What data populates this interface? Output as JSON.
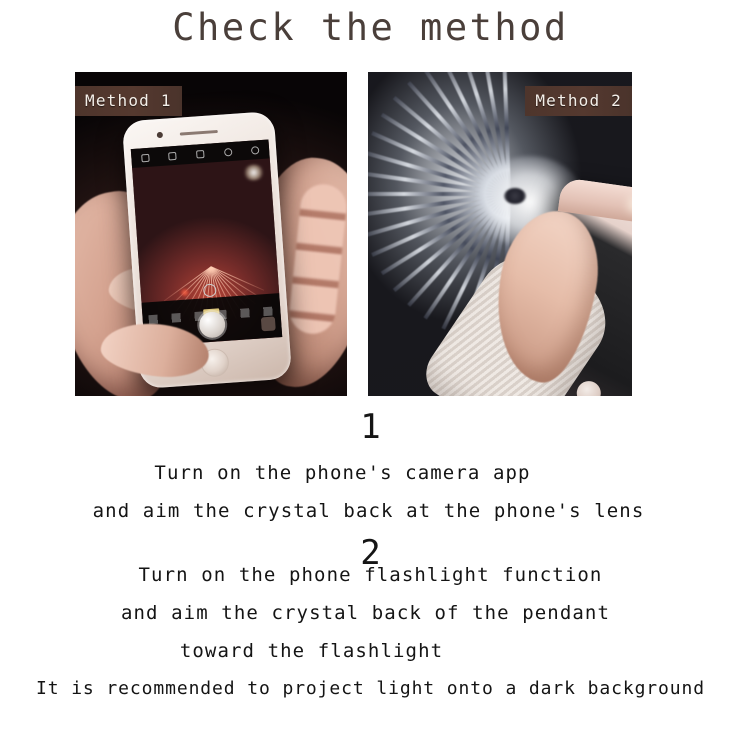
{
  "page": {
    "title": "Check the method",
    "background_color": "#ffffff",
    "title_color": "#4a3f3a",
    "text_color": "#141414"
  },
  "panels": [
    {
      "badge_label": "Method 1",
      "badge_position": "left",
      "badge_bg_color": "#4a332c",
      "badge_text_color": "#f4efe9",
      "scene": "two hands holding a white iPhone in a dark room with the camera app open, showing the crystal's radiating projection on screen"
    },
    {
      "badge_label": "Method 2",
      "badge_position": "right",
      "badge_bg_color": "#4a332c",
      "badge_text_color": "#f4efe9",
      "scene": "a hand holding a rose-gold iPhone with the flashlight on, projecting radial lines of text onto a dark surface"
    }
  ],
  "steps": [
    {
      "number": "1",
      "lines": [
        "Turn on the phone's camera app",
        "and aim the crystal back at the phone's lens"
      ]
    },
    {
      "number": "2",
      "lines": [
        "Turn on the phone flashlight function",
        "and aim the crystal back of the pendant",
        "toward the flashlight"
      ]
    }
  ],
  "note": "It is recommended to project light onto a dark background"
}
